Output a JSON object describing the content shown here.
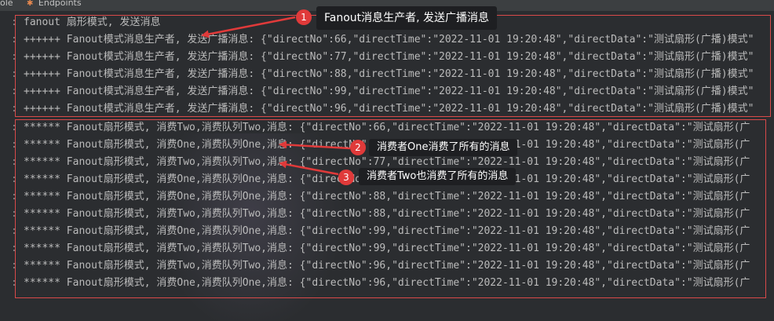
{
  "tabs": [
    {
      "label": "ole"
    },
    {
      "label": "Endpoints",
      "icon": "endpoints-icon"
    }
  ],
  "console": {
    "header_line": "fanout 扇形模式, 发送消息",
    "producer_lines": [
      "++++++ Fanout模式消息生产者, 发送广播消息: {\"directNo\":66,\"directTime\":\"2022-11-01 19:20:48\",\"directData\":\"测试扇形(广播)模式\"",
      "++++++ Fanout模式消息生产者, 发送广播消息: {\"directNo\":77,\"directTime\":\"2022-11-01 19:20:48\",\"directData\":\"测试扇形(广播)模式\"",
      "++++++ Fanout模式消息生产者, 发送广播消息: {\"directNo\":88,\"directTime\":\"2022-11-01 19:20:48\",\"directData\":\"测试扇形(广播)模式\"",
      "++++++ Fanout模式消息生产者, 发送广播消息: {\"directNo\":99,\"directTime\":\"2022-11-01 19:20:48\",\"directData\":\"测试扇形(广播)模式\"",
      "++++++ Fanout模式消息生产者, 发送广播消息: {\"directNo\":96,\"directTime\":\"2022-11-01 19:20:48\",\"directData\":\"测试扇形(广播)模式\""
    ],
    "consumer_lines": [
      "****** Fanout扇形模式, 消费Two,消费队列Two,消息: {\"directNo\":66,\"directTime\":\"2022-11-01 19:20:48\",\"directData\":\"测试扇形(广",
      "****** Fanout扇形模式, 消费One,消费队列One,消息: {\"directNo\":66,\"directTime\":\"2022-11-01 19:20:48\",\"directData\":\"测试扇形(广",
      "****** Fanout扇形模式, 消费Two,消费队列Two,消息: {\"directNo\":77,\"directTime\":\"2022-11-01 19:20:48\",\"directData\":\"测试扇形(广",
      "****** Fanout扇形模式, 消费One,消费队列One,消息: {\"directNo\":77,\"directTime\":\"2022-11-01 19:20:48\",\"directData\":\"测试扇形(广",
      "****** Fanout扇形模式, 消费One,消费队列One,消息: {\"directNo\":88,\"directTime\":\"2022-11-01 19:20:48\",\"directData\":\"测试扇形(广",
      "****** Fanout扇形模式, 消费Two,消费队列Two,消息: {\"directNo\":88,\"directTime\":\"2022-11-01 19:20:48\",\"directData\":\"测试扇形(广",
      "****** Fanout扇形模式, 消费One,消费队列One,消息: {\"directNo\":99,\"directTime\":\"2022-11-01 19:20:48\",\"directData\":\"测试扇形(广",
      "****** Fanout扇形模式, 消费Two,消费队列Two,消息: {\"directNo\":99,\"directTime\":\"2022-11-01 19:20:48\",\"directData\":\"测试扇形(广",
      "****** Fanout扇形模式, 消费Two,消费队列Two,消息: {\"directNo\":96,\"directTime\":\"2022-11-01 19:20:48\",\"directData\":\"测试扇形(广",
      "****** Fanout扇形模式, 消费One,消费队列One,消息: {\"directNo\":96,\"directTime\":\"2022-11-01 19:20:48\",\"directData\":\"测试扇形(广"
    ]
  },
  "annotations": [
    {
      "number": "1",
      "text": "Fanout消息生产者, 发送广播消息"
    },
    {
      "number": "2",
      "text": "消费者One消费了所有的消息"
    },
    {
      "number": "3",
      "text": "消费者Two也消费了所有的消息"
    }
  ],
  "colors": {
    "background": "#2b2d30",
    "text": "#bbbbbb",
    "highlight_box": "#d94a4a",
    "badge": "#e03a3a",
    "callout_bg": "#1e1f22"
  }
}
